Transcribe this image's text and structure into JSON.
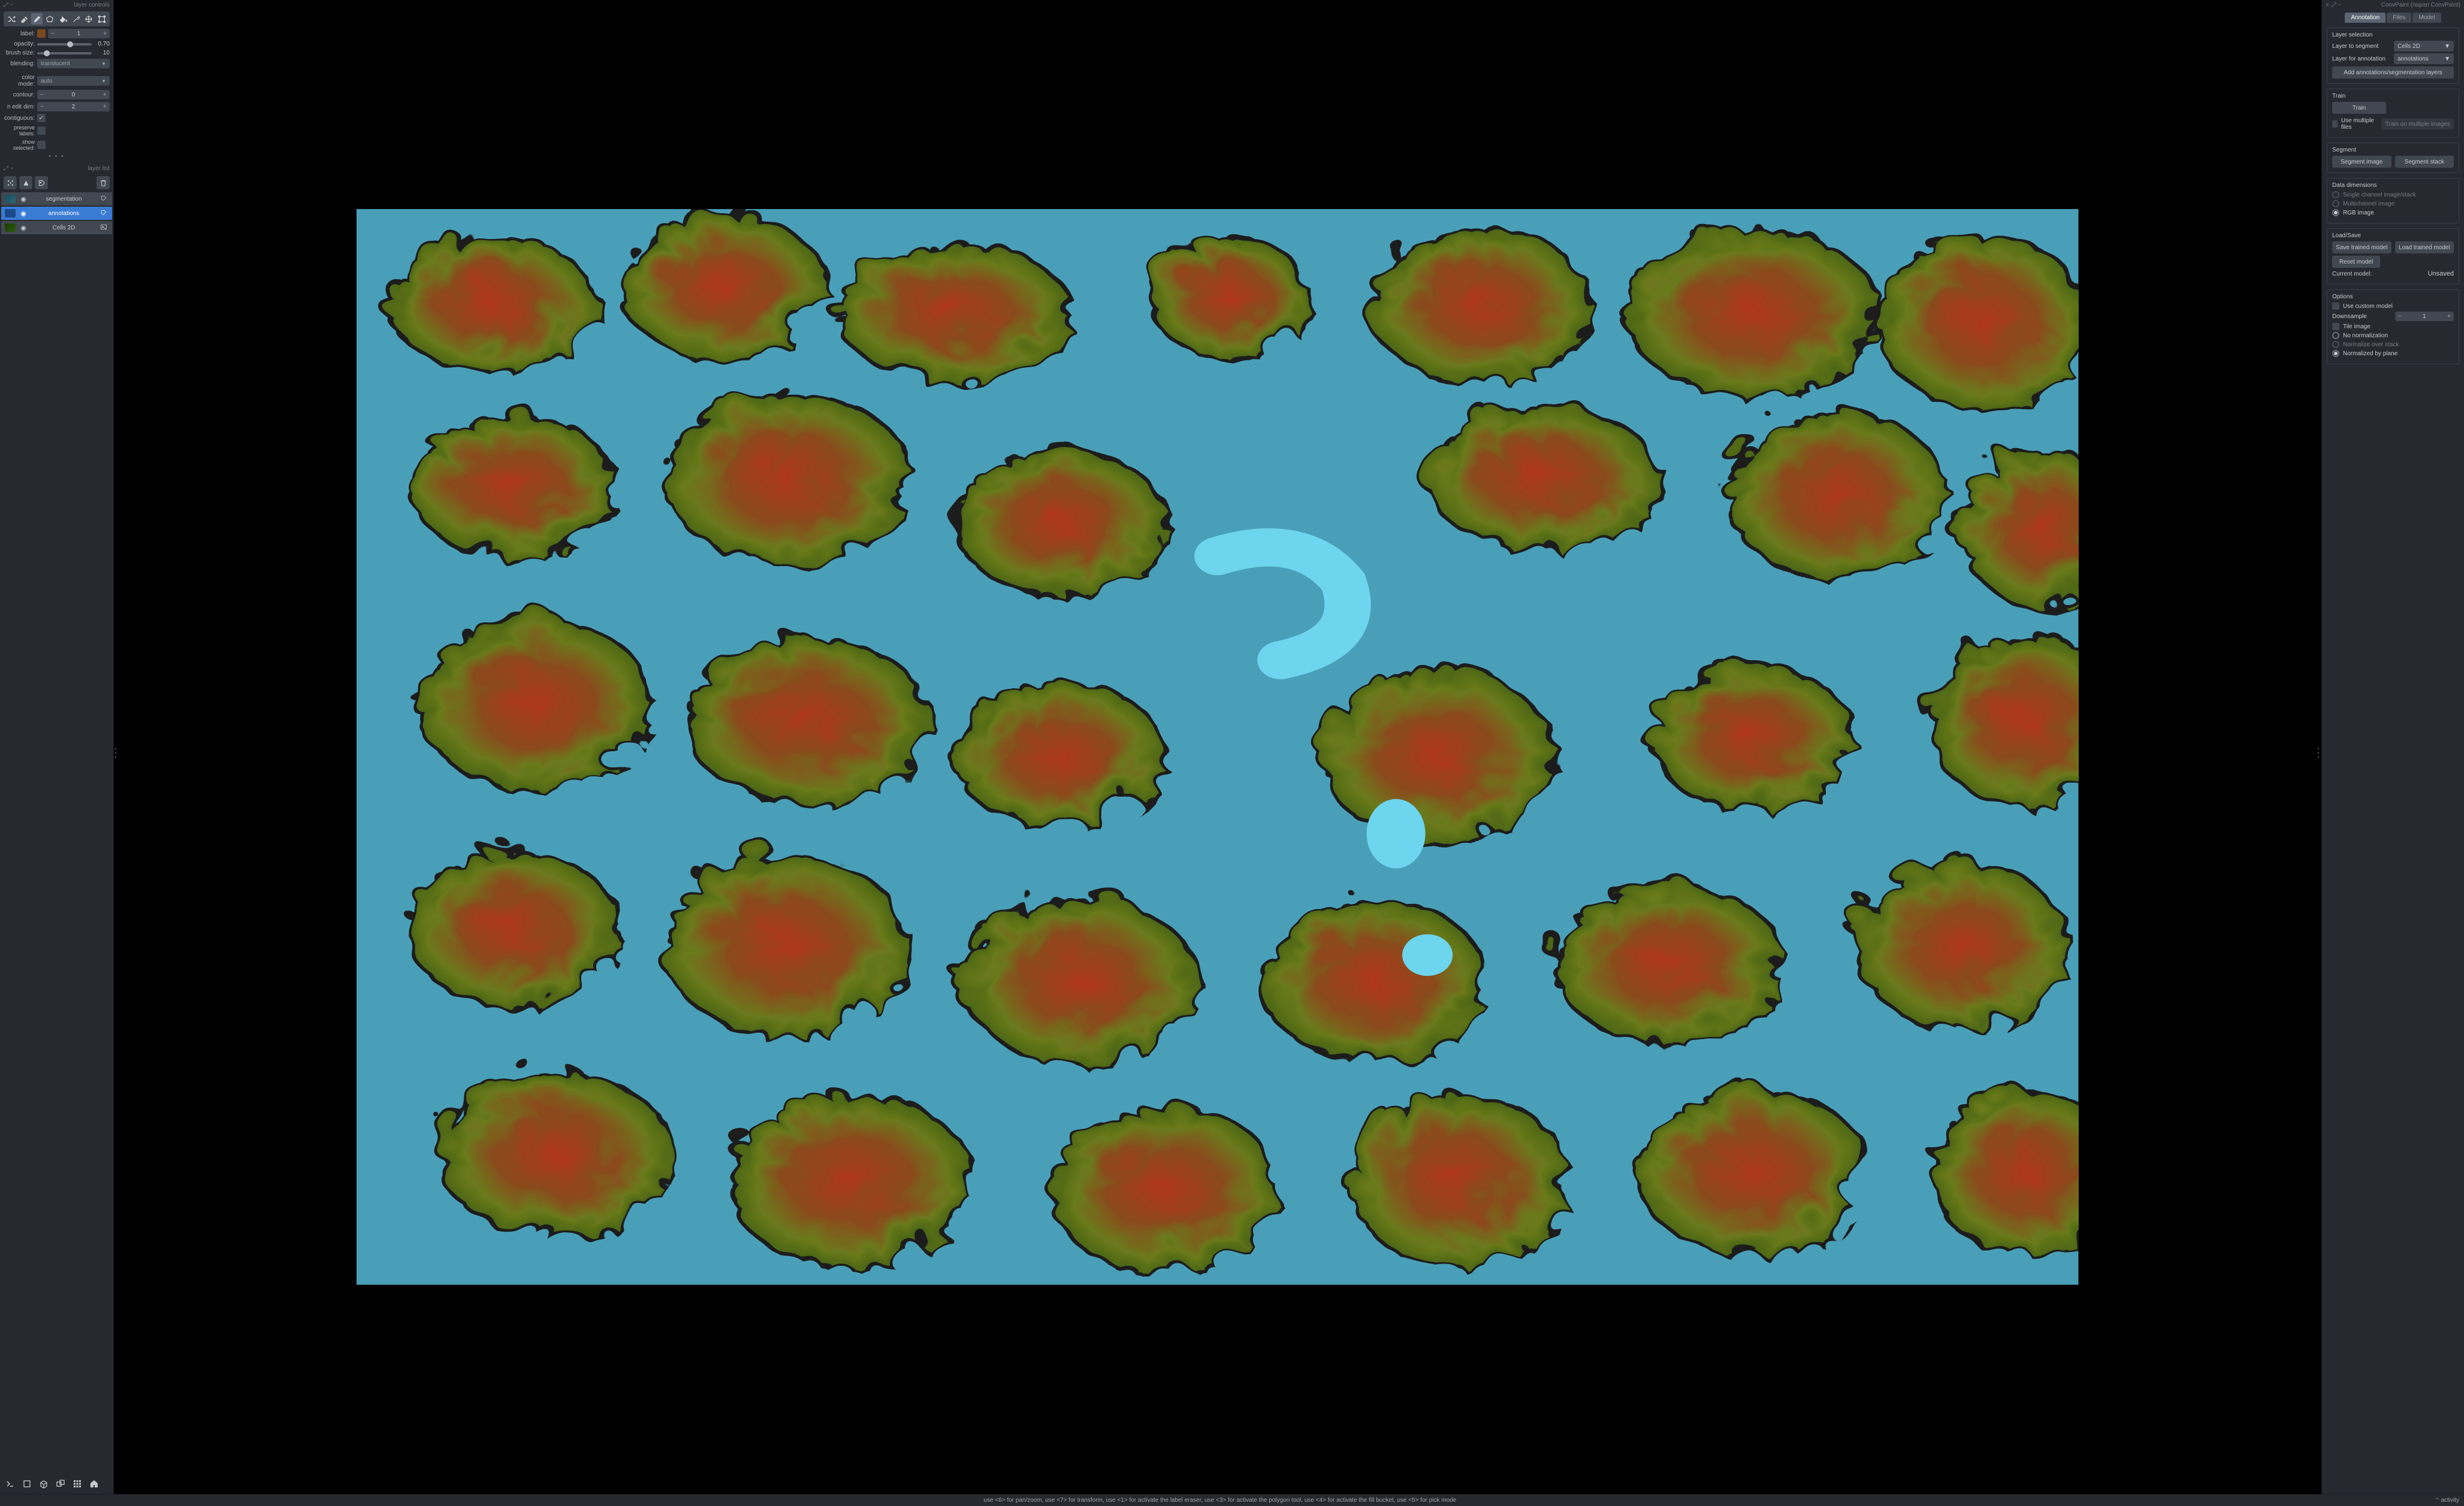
{
  "leftPanel": {
    "layerControlsTitle": "layer controls",
    "labelLabel": "label:",
    "labelValue": "1",
    "opacityLabel": "opacity:",
    "opacityValue": "0.70",
    "brushSizeLabel": "brush size:",
    "brushSizeValue": "10",
    "blendingLabel": "blending:",
    "blendingValue": "translucent",
    "colorModeLabel": "color mode:",
    "colorModeValue": "auto",
    "contourLabel": "contour:",
    "contourValue": "0",
    "nEditDimLabel": "n edit dim:",
    "nEditDimValue": "2",
    "contiguousLabel": "contiguous:",
    "preserveLabelsLabel": "preserve labels:",
    "showSelectedLabel": "show selected:",
    "layerListTitle": "layer list",
    "layers": [
      {
        "name": "segmentation",
        "selected": false
      },
      {
        "name": "annotations",
        "selected": true
      },
      {
        "name": "Cells 2D",
        "selected": false
      }
    ]
  },
  "rightPanel": {
    "title": "ConvPaint (napari ConvPaint)",
    "tabs": [
      "Annotation",
      "Files",
      "Model"
    ],
    "layerSelection": {
      "title": "Layer selection",
      "segmentLbl": "Layer to segment",
      "segmentVal": "Cells 2D",
      "annotLbl": "Layer for annotation",
      "annotVal": "annotations",
      "addBtn": "Add annotations/segmentation layers"
    },
    "train": {
      "title": "Train",
      "trainBtn": "Train",
      "multiFiles": "Use multiple files",
      "trainMulti": "Train on multiple images"
    },
    "segment": {
      "title": "Segment",
      "segImg": "Segment image",
      "segStack": "Segment stack"
    },
    "dataDim": {
      "title": "Data dimensions",
      "opt1": "Single channel image/stack",
      "opt2": "Multichannel image",
      "opt3": "RGB image"
    },
    "loadSave": {
      "title": "Load/Save",
      "save": "Save trained model",
      "load": "Load trained model",
      "reset": "Reset model",
      "currentLbl": "Current model:",
      "currentVal": "Unsaved"
    },
    "options": {
      "title": "Options",
      "custom": "Use custom model",
      "downsampleLbl": "Downsample",
      "downsampleVal": "1",
      "tile": "Tile image",
      "noNorm": "No normalization",
      "normStack": "Normalize over stack",
      "normPlane": "Normalized by plane"
    }
  },
  "statusBar": {
    "hint": "use <6> for pan/zoom, use <7> for transform, use <1> for activate the label eraser, use <3> for activate the polygon tool, use <4> for activate the fill bucket, use <5> for pick mode",
    "activity": "activity"
  }
}
